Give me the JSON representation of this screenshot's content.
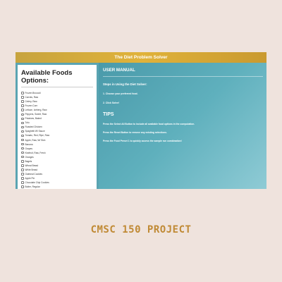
{
  "window": {
    "title": "The Diet Problem Solver"
  },
  "sidebar": {
    "heading": "Available Foods Options:",
    "foods": [
      "Frozen Broccoli",
      "Carrots, Raw",
      "Celery, Raw",
      "Frozen Corn",
      "Lettuce, Iceberg, Raw",
      "Peppers, Sweet, Raw",
      "Potatoes, Baked",
      "Tofu",
      "Roasted Chicken",
      "Spaghetti W/ Sauce",
      "Tomato, Red, Ripe, Raw",
      "Apple, Raw, W/ Skin",
      "Banana",
      "Grapes",
      "Kiwifruit, Raw, Fresh",
      "Oranges",
      "Bagels",
      "Wheat Bread",
      "White Bread",
      "Oatmeal Cookies",
      "Apple Pie",
      "Chocolate Chip Cookies",
      "Butter, Regular"
    ]
  },
  "main": {
    "manual_title": "USER MANUAL",
    "steps_title": "Steps in Using the Diet Solver:",
    "step1": "1. Choose your preferred food.",
    "step2": "2. Click Solve!",
    "tips_title": "TIPS",
    "tip1": "Press the Select All Button to include all available food options in the computation.",
    "tip2": "Press the Reset Button to remove any existing selections.",
    "tip3": "Press the Food Preset 1 to quickly access the sample run combination!"
  },
  "caption": "CMSC 150 PROJECT",
  "colors": {
    "background": "#efe3dd",
    "titlebar": "#d4a83a",
    "panel": "#5aa4b2",
    "caption": "#c08a35"
  }
}
